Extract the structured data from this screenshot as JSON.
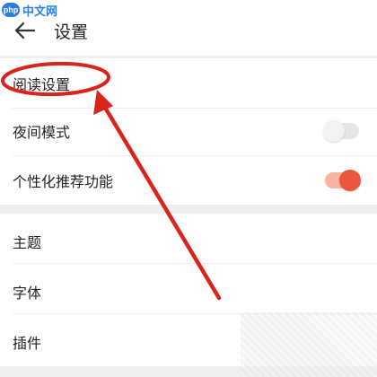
{
  "watermark": {
    "logo_text": "php",
    "text": "中文网"
  },
  "header": {
    "title": "设置",
    "back_icon": "arrow-left-icon"
  },
  "settings_group_1": [
    {
      "label": "阅读设置"
    },
    {
      "label": "夜间模式",
      "toggle": false
    },
    {
      "label": "个性化推荐功能",
      "toggle": true
    }
  ],
  "settings_group_2": [
    {
      "label": "主题"
    },
    {
      "label": "字体"
    },
    {
      "label": "插件"
    }
  ],
  "colors": {
    "accent_toggle": "#e9553d",
    "annotation_red": "#d8241a",
    "watermark_blue": "#2a7de1"
  }
}
